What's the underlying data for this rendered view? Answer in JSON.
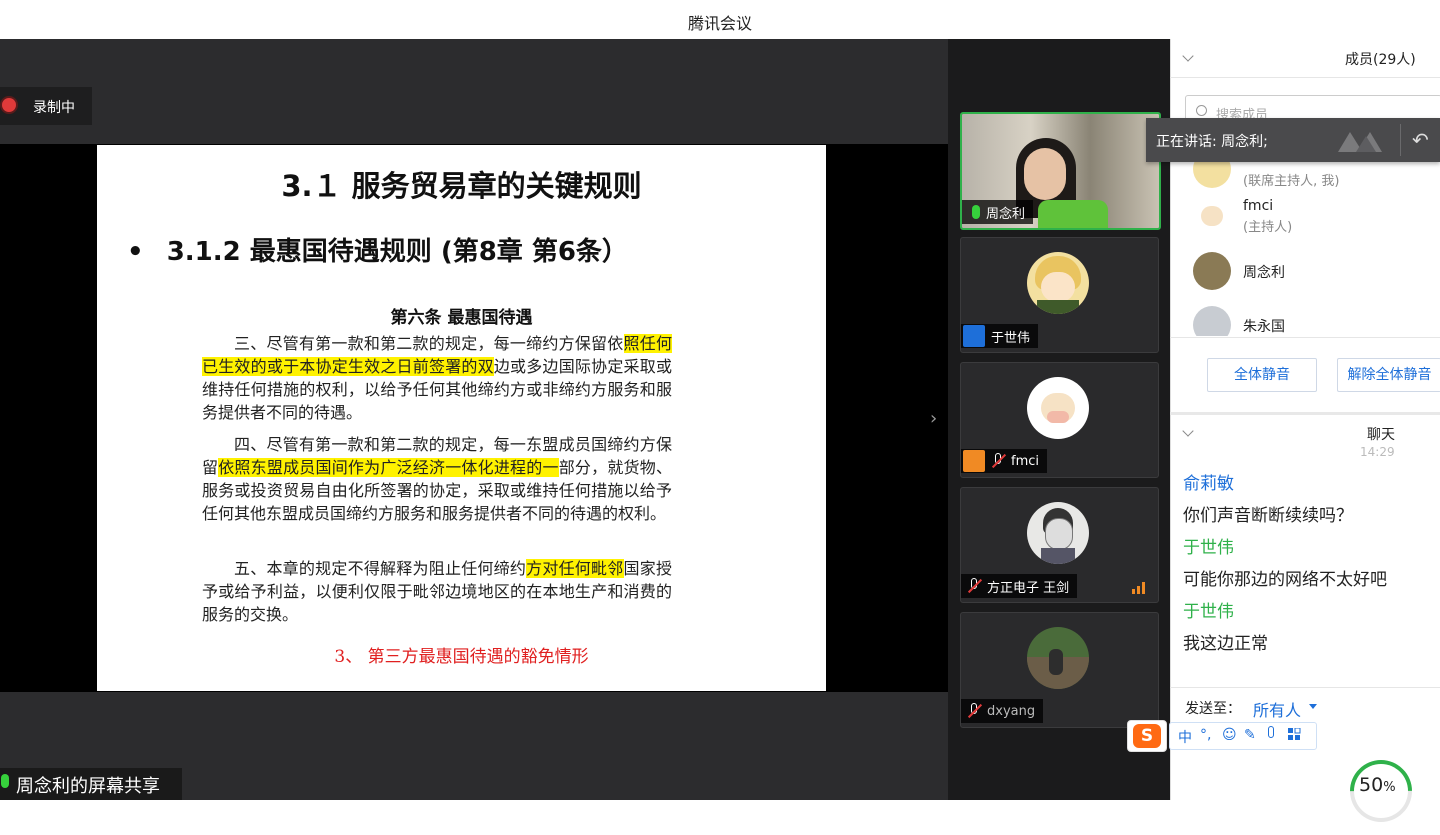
{
  "window": {
    "title": "腾讯会议"
  },
  "recording": {
    "label": "录制中"
  },
  "slide": {
    "title": "3.１ 服务贸易章的关键规则",
    "bullet": "•",
    "subtitle": "3.1.2  最惠国待遇规则 (第8章 第6条）",
    "doc_heading": "第六条  最惠国待遇",
    "para3": {
      "pre": "三、尽管有第一款和第二款的规定，每一缔约方保留依",
      "hl": "照任何已生效的或于本协定生效之日前签署的双",
      "post": "边或多边国际协定采取或维持任何措施的权利，以给予任何其他缔约方或非缔约方服务和服务提供者不同的待遇。"
    },
    "para4": {
      "pre": "四、尽管有第一款和第二款的规定，每一东盟成员国缔约方保留",
      "hl": "依照东盟成员国间作为广泛经济一体化进程的一",
      "post": "部分，就货物、服务或投资贸易自由化所签署的协定，采取或维持任何措施以给予任何其他东盟成员国缔约方服务和服务提供者不同的待遇的权利。"
    },
    "para5": {
      "pre": "五、本章的规定不得解释为阻止任何缔约",
      "hl": "方对任何毗邻",
      "post": "国家授予或给予利益，以便利仅限于毗邻边境地区的在本地生产和消费的服务的交换。"
    },
    "footer": "3、 第三方最惠国待遇的豁免情形"
  },
  "sharer": {
    "label": "周念利的屏幕共享"
  },
  "videos": [
    {
      "name": "周念利",
      "active": true
    },
    {
      "name": "于世伟"
    },
    {
      "name": "fmci"
    },
    {
      "name": "方正电子 王剑"
    },
    {
      "name": "dxyang"
    }
  ],
  "members": {
    "title": "成员(29人)",
    "search_placeholder": "搜索成员",
    "speaking": "正在讲话: 周念利;",
    "list": [
      {
        "name": "",
        "role": "(联席主持人, 我)"
      },
      {
        "name": "fmci",
        "role": "(主持人)"
      },
      {
        "name": "周念利",
        "role": ""
      },
      {
        "name": "朱永国",
        "role": ""
      }
    ],
    "mute_all": "全体静音",
    "unmute_all": "解除全体静音"
  },
  "chat": {
    "title": "聊天",
    "timestamp": "14:29",
    "messages": [
      {
        "sender": "俞莉敏",
        "text": "你们声音断断续续吗？",
        "sender_color": "#1e6fd9"
      },
      {
        "sender": "于世伟",
        "text": "可能你那边的网络不太好吧",
        "sender_color": "#2fb14a"
      },
      {
        "sender": "于世伟",
        "text": "我这边正常",
        "sender_color": "#2fb14a"
      }
    ],
    "send_to_label": "发送至：",
    "send_to_value": "所有人"
  },
  "ime": {
    "logo": "S",
    "lang": "中",
    "punct": "°,"
  },
  "progress": {
    "value": "50",
    "unit": "%"
  }
}
